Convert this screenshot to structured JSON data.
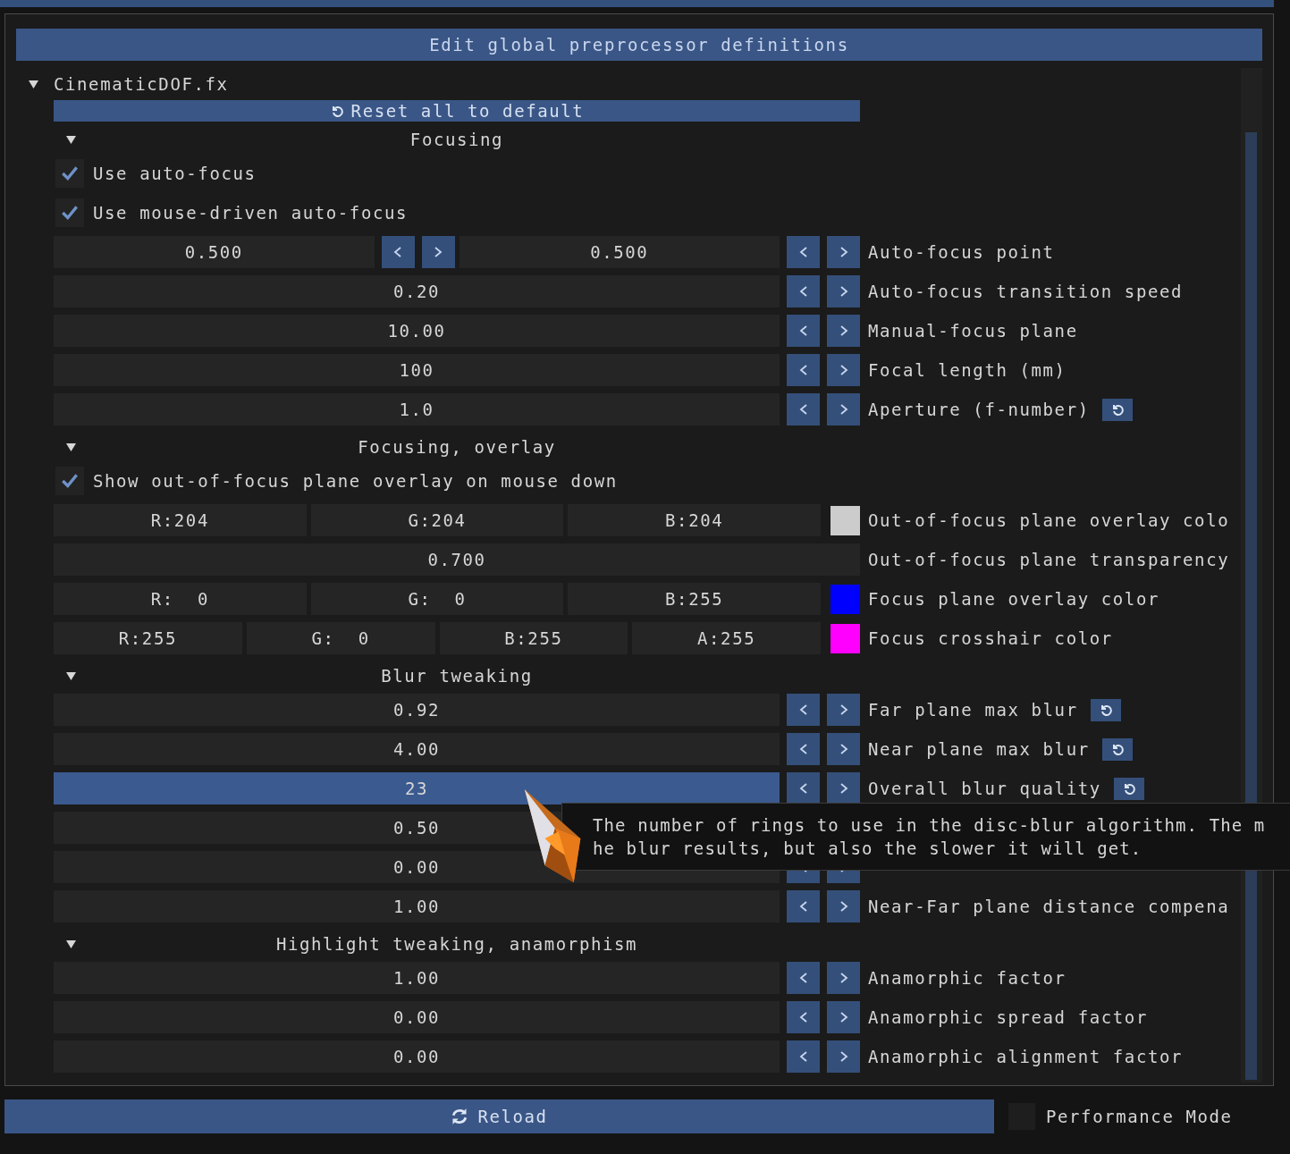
{
  "header": {
    "title": "Edit global preprocessor definitions"
  },
  "effect": {
    "name": "CinematicDOF.fx",
    "expanded": true
  },
  "reset_all": {
    "label": "Reset all to default"
  },
  "sections": [
    {
      "title": "Focusing",
      "expanded": true,
      "items": [
        {
          "kind": "checkbox",
          "label": "Use auto-focus",
          "checked": true
        },
        {
          "kind": "checkbox",
          "label": "Use mouse-driven auto-focus",
          "checked": true
        },
        {
          "kind": "drag",
          "values": [
            "0.500",
            "0.500"
          ],
          "label": "Auto-focus point",
          "active": false,
          "reset": false
        },
        {
          "kind": "drag",
          "values": [
            "0.20"
          ],
          "label": "Auto-focus transition speed",
          "active": false,
          "reset": false
        },
        {
          "kind": "drag",
          "values": [
            "10.00"
          ],
          "label": "Manual-focus plane",
          "active": false,
          "reset": false
        },
        {
          "kind": "drag",
          "values": [
            "100"
          ],
          "label": "Focal length (mm)",
          "active": false,
          "reset": false
        },
        {
          "kind": "drag",
          "values": [
            "1.0"
          ],
          "label": "Aperture (f-number)",
          "active": false,
          "reset": true
        }
      ]
    },
    {
      "title": "Focusing, overlay",
      "expanded": true,
      "items": [
        {
          "kind": "checkbox",
          "label": "Show out-of-focus plane overlay on mouse down",
          "checked": true
        },
        {
          "kind": "color",
          "values": [
            "R:204",
            "G:204",
            "B:204"
          ],
          "color": "#cccccc",
          "label": "Out-of-focus plane overlay colo"
        },
        {
          "kind": "plain",
          "values": [
            "0.700"
          ],
          "label": "Out-of-focus plane transparency"
        },
        {
          "kind": "color",
          "values": [
            "R:  0",
            "G:  0",
            "B:255"
          ],
          "color": "#0000ff",
          "label": "Focus plane overlay color"
        },
        {
          "kind": "color",
          "values": [
            "R:255",
            "G:  0",
            "B:255",
            "A:255"
          ],
          "color": "#ff00ff",
          "label": "Focus crosshair color"
        }
      ]
    },
    {
      "title": "Blur tweaking",
      "expanded": true,
      "items": [
        {
          "kind": "drag",
          "values": [
            "0.92"
          ],
          "label": "Far plane max blur",
          "active": false,
          "reset": true
        },
        {
          "kind": "drag",
          "values": [
            "4.00"
          ],
          "label": "Near plane max blur",
          "active": false,
          "reset": true
        },
        {
          "kind": "drag",
          "values": [
            "23"
          ],
          "label": "Overall blur quality",
          "active": true,
          "reset": true
        },
        {
          "kind": "covered",
          "values": [
            "0.50"
          ]
        },
        {
          "kind": "drag",
          "values": [
            "0.00"
          ],
          "active": false,
          "reset": false
        },
        {
          "kind": "drag",
          "values": [
            "1.00"
          ],
          "label": "Near-Far plane distance compena",
          "active": false,
          "reset": false
        }
      ]
    },
    {
      "title": "Highlight tweaking, anamorphism",
      "expanded": true,
      "items": [
        {
          "kind": "drag",
          "values": [
            "1.00"
          ],
          "label": "Anamorphic factor",
          "active": false,
          "reset": false
        },
        {
          "kind": "drag",
          "values": [
            "0.00"
          ],
          "label": "Anamorphic spread factor",
          "active": false,
          "reset": false
        },
        {
          "kind": "drag",
          "values": [
            "0.00"
          ],
          "label": "Anamorphic alignment factor",
          "active": false,
          "reset": false
        }
      ]
    }
  ],
  "tooltip": {
    "lines": [
      "The number of rings to use in the disc-blur algorithm. The m",
      "he blur results, but also the slower it will get."
    ]
  },
  "reload_button": {
    "label": "Reload"
  },
  "performance_mode": {
    "label": "Performance Mode",
    "checked": false
  }
}
